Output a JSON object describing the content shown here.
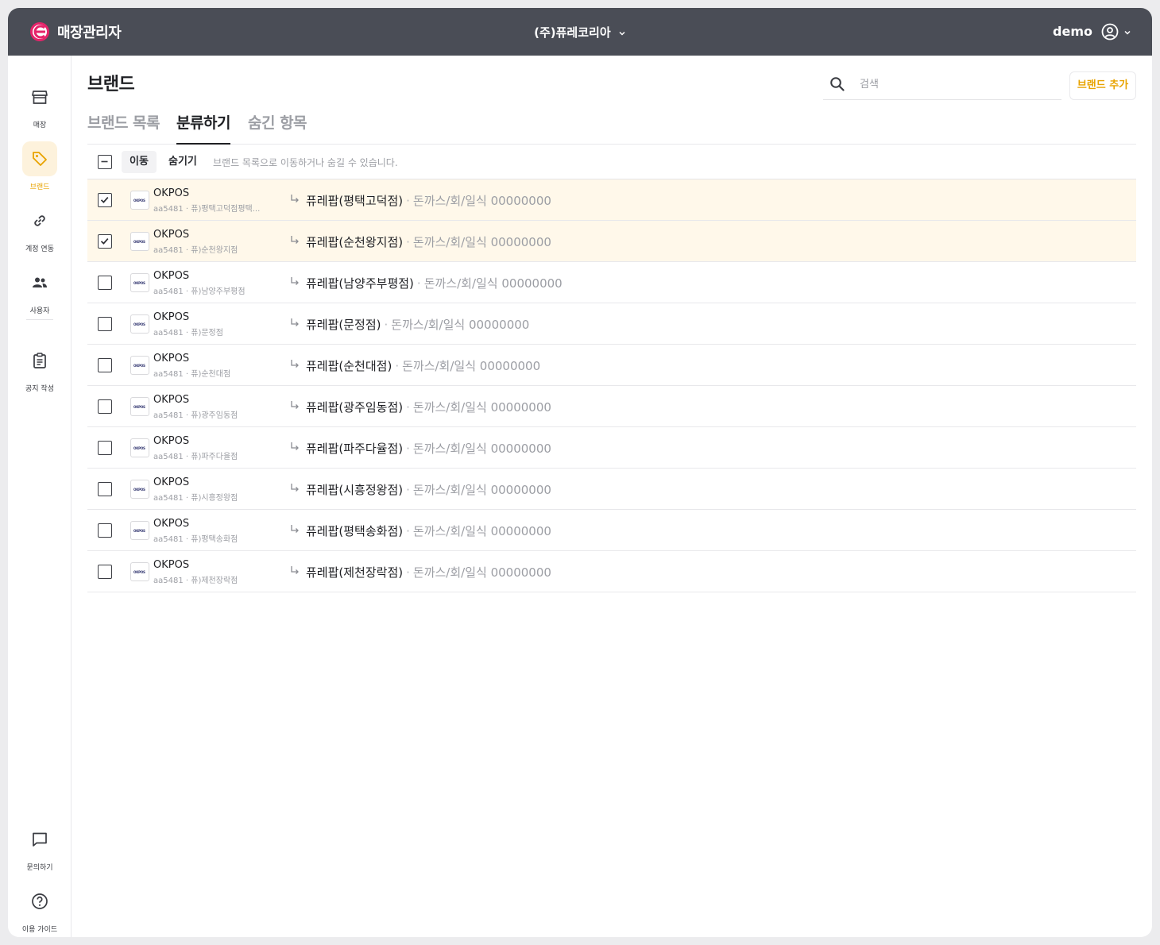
{
  "header": {
    "app_title": "매장관리자",
    "company": "(주)퓨레코리아",
    "user": "demo",
    "brand_color": "#e8a300",
    "logo_color": "#e5246a"
  },
  "sidebar": {
    "items": [
      {
        "label": "매장",
        "icon": "store-icon"
      },
      {
        "label": "브랜드",
        "icon": "tag-icon",
        "active": true
      },
      {
        "label": "계정 연동",
        "icon": "link-icon"
      },
      {
        "label": "사용자",
        "icon": "users-icon"
      },
      {
        "label": "공지 작성",
        "icon": "clipboard-icon"
      },
      {
        "label": "문의하기",
        "icon": "chat-icon"
      },
      {
        "label": "이용 가이드",
        "icon": "help-icon"
      }
    ]
  },
  "main": {
    "title": "브랜드",
    "search_placeholder": "검색",
    "add_button": "브랜드 추가",
    "tabs": [
      {
        "label": "브랜드 목록"
      },
      {
        "label": "분류하기",
        "active": true
      },
      {
        "label": "숨긴 항목"
      }
    ],
    "toolbar": {
      "move": "이동",
      "hide": "숨기기",
      "hint": "브랜드 목록으로 이동하거나 숨길 수 있습니다."
    },
    "rows": [
      {
        "brand": "OKPOS",
        "sub": "aa5481 · 퓨)평택고덕점평택...",
        "store": "퓨레팝(평택고덕점)",
        "meta": "돈까스/회/일식 00000000",
        "checked": true
      },
      {
        "brand": "OKPOS",
        "sub": "aa5481 · 퓨)순천왕지점",
        "store": "퓨레팝(순천왕지점)",
        "meta": "돈까스/회/일식 00000000",
        "checked": true
      },
      {
        "brand": "OKPOS",
        "sub": "aa5481 · 퓨)남양주부평점",
        "store": "퓨레팝(남양주부평점)",
        "meta": "돈까스/회/일식 00000000",
        "checked": false
      },
      {
        "brand": "OKPOS",
        "sub": "aa5481 · 퓨)문정점",
        "store": "퓨레팝(문정점)",
        "meta": "돈까스/회/일식 00000000",
        "checked": false
      },
      {
        "brand": "OKPOS",
        "sub": "aa5481 · 퓨)순천대점",
        "store": "퓨레팝(순천대점)",
        "meta": "돈까스/회/일식 00000000",
        "checked": false
      },
      {
        "brand": "OKPOS",
        "sub": "aa5481 · 퓨)광주임동점",
        "store": "퓨레팝(광주임동점)",
        "meta": "돈까스/회/일식 00000000",
        "checked": false
      },
      {
        "brand": "OKPOS",
        "sub": "aa5481 · 퓨)파주다율점",
        "store": "퓨레팝(파주다율점)",
        "meta": "돈까스/회/일식 00000000",
        "checked": false
      },
      {
        "brand": "OKPOS",
        "sub": "aa5481 · 퓨)시흥정왕점",
        "store": "퓨레팝(시흥정왕점)",
        "meta": "돈까스/회/일식 00000000",
        "checked": false
      },
      {
        "brand": "OKPOS",
        "sub": "aa5481 · 퓨)평택송화점",
        "store": "퓨레팝(평택송화점)",
        "meta": "돈까스/회/일식 00000000",
        "checked": false
      },
      {
        "brand": "OKPOS",
        "sub": "aa5481 · 퓨)제천장락점",
        "store": "퓨레팝(제천장락점)",
        "meta": "돈까스/회/일식 00000000",
        "checked": false
      }
    ]
  }
}
